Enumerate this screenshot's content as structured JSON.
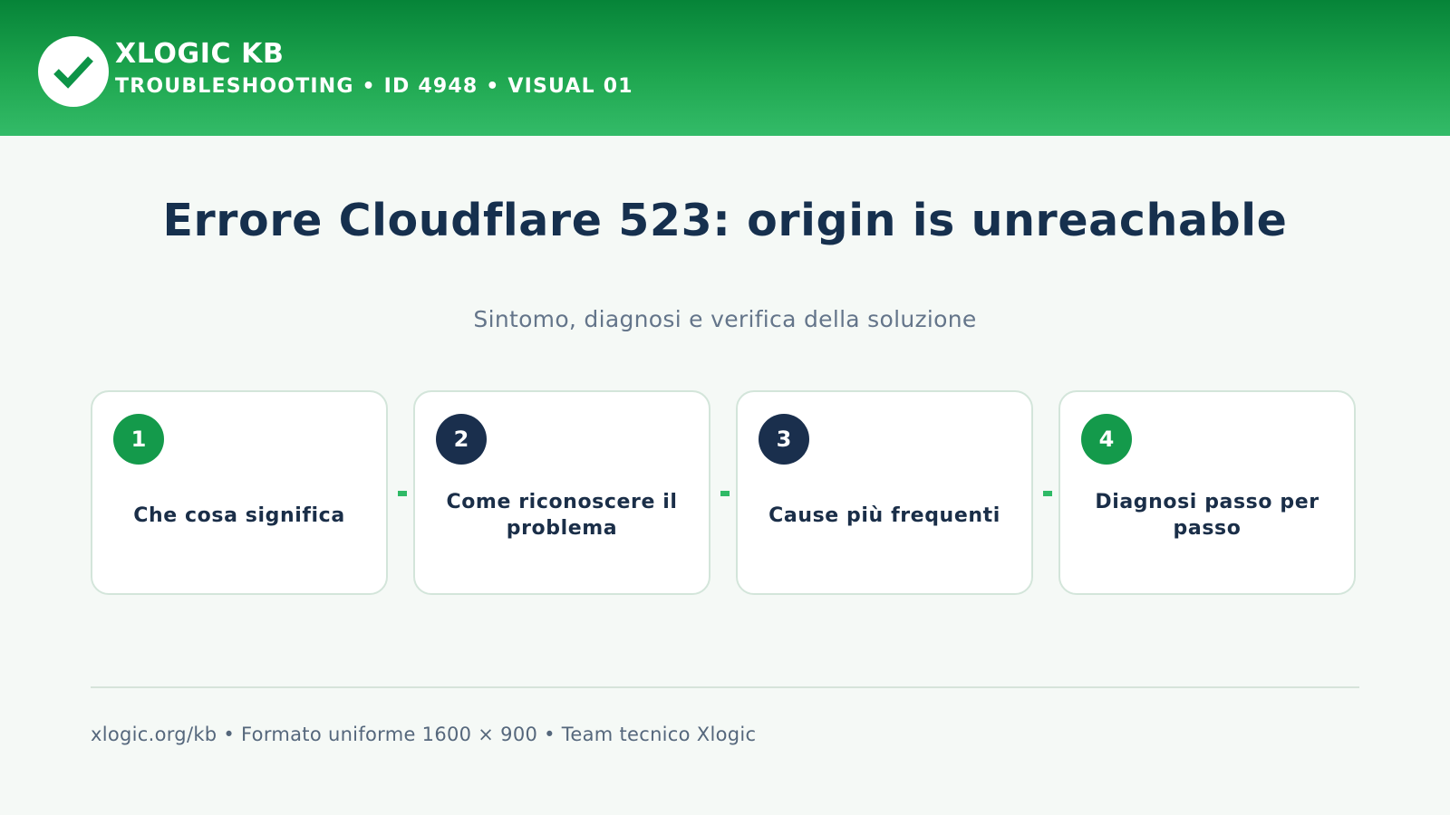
{
  "header": {
    "brand": "XLOGIC KB",
    "subtitle": "TROUBLESHOOTING • ID 4948 • VISUAL 01",
    "logo_icon": "check-icon",
    "colors": {
      "gradient_top": "#068438",
      "gradient_bottom": "#33bb68"
    }
  },
  "title": "Errore Cloudflare 523: origin is unreachable",
  "subtitle": "Sintomo, diagnosi e verifica della soluzione",
  "steps": [
    {
      "number": "1",
      "label": "Che cosa significa",
      "badge_color": "#149a4b"
    },
    {
      "number": "2",
      "label": "Come riconoscere il problema",
      "badge_color": "#1a2f4d"
    },
    {
      "number": "3",
      "label": "Cause più frequenti",
      "badge_color": "#1a2f4d"
    },
    {
      "number": "4",
      "label": "Diagnosi passo per passo",
      "badge_color": "#149a4b"
    }
  ],
  "footer": "xlogic.org/kb • Formato uniforme 1600 × 900 • Team tecnico Xlogic"
}
